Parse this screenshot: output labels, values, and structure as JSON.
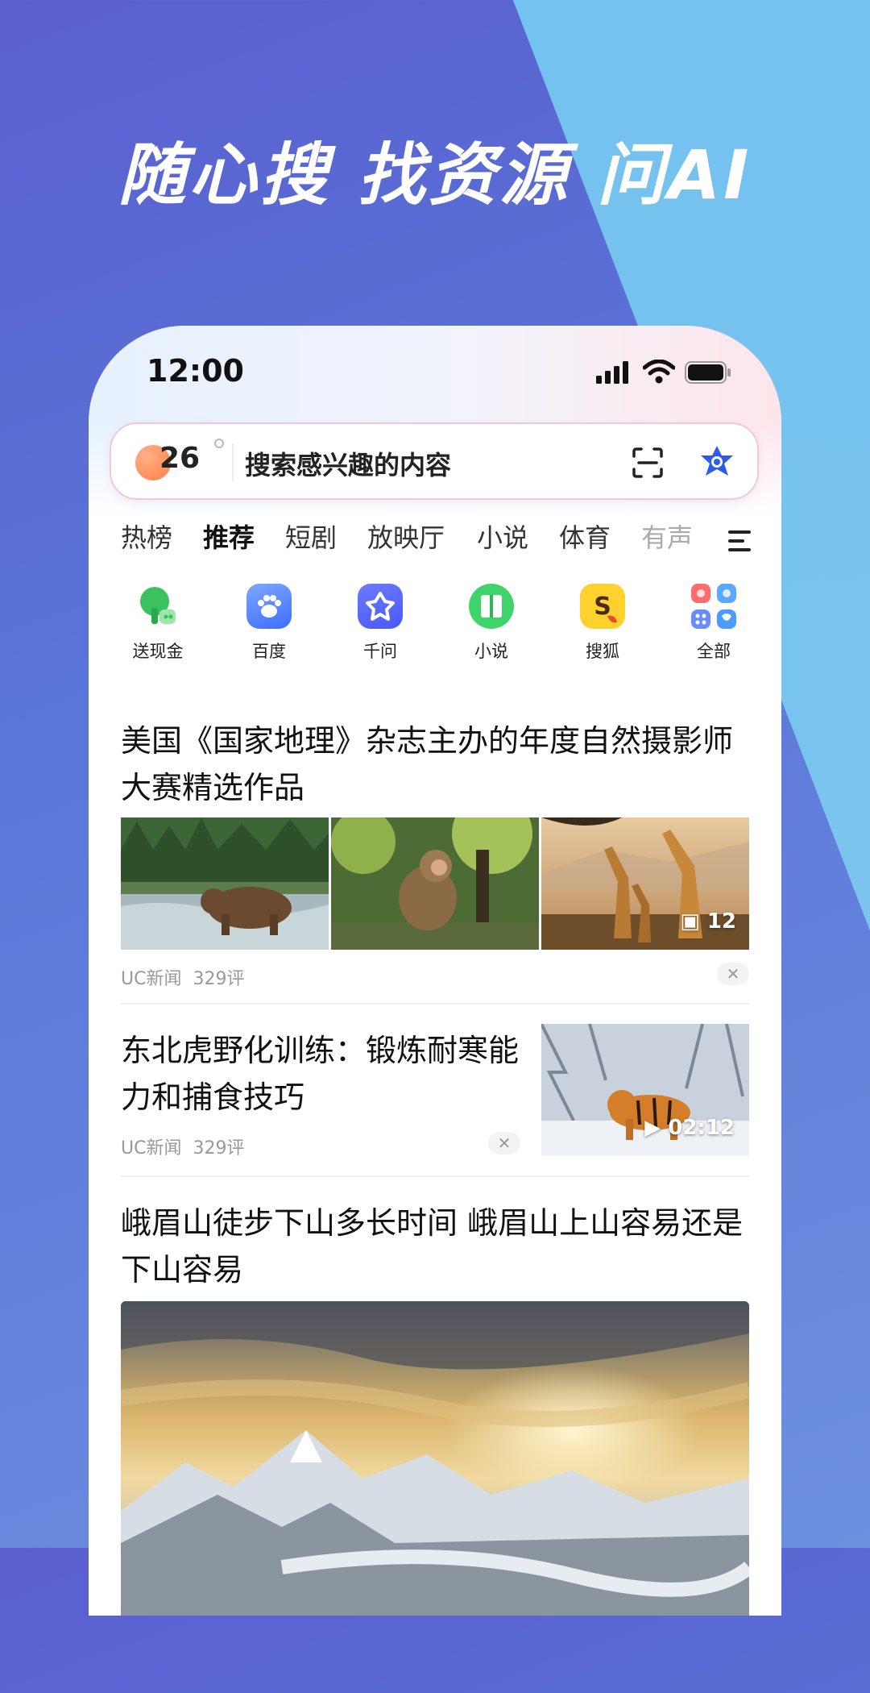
{
  "headline": "随心搜 找资源 问AI",
  "status": {
    "time": "12:00"
  },
  "search": {
    "weather_temp": "26",
    "placeholder": "搜索感兴趣的内容"
  },
  "tabs": [
    "热榜",
    "推荐",
    "短剧",
    "放映厅",
    "小说",
    "体育",
    "有声"
  ],
  "active_tab": "推荐",
  "apps": [
    {
      "label": "送现金",
      "icon": "tree-icon"
    },
    {
      "label": "百度",
      "icon": "paw-icon"
    },
    {
      "label": "千问",
      "icon": "qianwen-icon"
    },
    {
      "label": "小说",
      "icon": "book-icon"
    },
    {
      "label": "搜狐",
      "icon": "sohu-icon"
    },
    {
      "label": "全部",
      "icon": "grid-icon"
    }
  ],
  "news": [
    {
      "title": "美国《国家地理》杂志主办的年度自然摄影师大赛精选作品",
      "source": "UC新闻",
      "comments": "329评",
      "image_count": "12"
    },
    {
      "title": "东北虎野化训练：锻炼耐寒能力和捕食技巧",
      "source": "UC新闻",
      "comments": "329评",
      "duration": "02:12"
    },
    {
      "title": "峨眉山徒步下山多长时间 峨眉山上山容易还是下山容易"
    }
  ],
  "colors": {
    "accent_blue": "#2f5bea",
    "bg_purple": "#5a5fd0",
    "bg_sky": "#74c6f2"
  }
}
